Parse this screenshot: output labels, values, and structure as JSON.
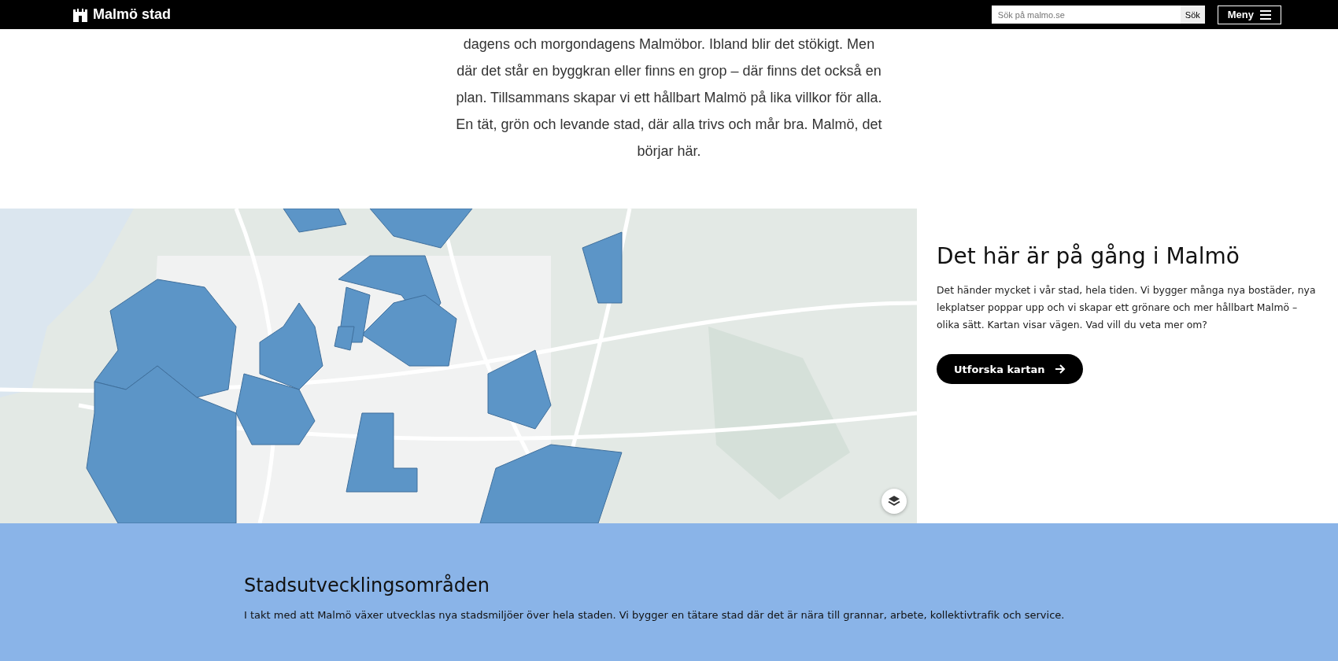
{
  "header": {
    "logo": "Malmö stad",
    "search": {
      "placeholder": "Sök på malmo.se",
      "button": "Sök"
    },
    "menu_button": "Meny"
  },
  "intro": {
    "lines": [
      "dagens och morgondagens Malmöbor. Ibland blir det stökigt. Men",
      "där det står en byggkran eller finns en grop – där finns det också en",
      "plan. Tillsammans skapar vi ett hållbart Malmö på lika villkor för alla.",
      "En tät, grön och levande stad, där alla trivs och mår bra. Malmö, det",
      "börjar här."
    ]
  },
  "map_section": {
    "title": "Det här är på gång i Malmö",
    "paragraph_lines": [
      "Det händer mycket i vår stad, hela tiden. Vi bygger många nya bostäder, nya",
      "lekplatser poppar upp och vi skapar ett grönare och mer hållbart Malmö –",
      "olika sätt. Kartan visar vägen. Vad vill du veta mer om?"
    ],
    "button": "Utforska kartan"
  },
  "areas": {
    "title": "Stadsutvecklingsområden",
    "description": "I takt med att Malmö växer utvecklas nya stadsmiljöer över hela staden. Vi bygger en tätare stad där det är nära till grannar, arbete, kollektivtrafik och service."
  }
}
